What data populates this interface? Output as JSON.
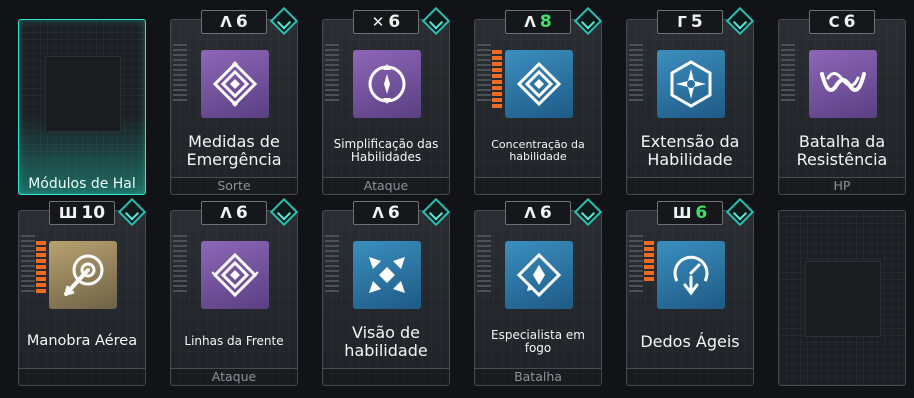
{
  "selected_slot": {
    "label": "Módulos de Hal"
  },
  "modules": [
    {
      "id": "m1",
      "level_glyph": "Λ",
      "level": "6",
      "level_color": "#f2f2f2",
      "name": "Medidas de Emergência",
      "tag": "Sorte",
      "icon": "diamond-lattice-icon",
      "tone": "purple",
      "bars": 0
    },
    {
      "id": "m2",
      "level_glyph": "✕",
      "level": "6",
      "level_color": "#f2f2f2",
      "name": "Simplificação das Habilidades",
      "tag": "Ataque",
      "icon": "circle-arrows-icon",
      "tone": "purple",
      "bars": 0
    },
    {
      "id": "m3",
      "level_glyph": "Λ",
      "level": "8",
      "level_color": "#3ee06a",
      "name": "Concentração da habilidade",
      "tag": "",
      "icon": "diamond-lattice-icon",
      "tone": "blue",
      "bars": 10
    },
    {
      "id": "m4",
      "level_glyph": "Г",
      "level": "5",
      "level_color": "#f2f2f2",
      "name": "Extensão da Habilidade",
      "tag": "",
      "icon": "hex-star-icon",
      "tone": "blue",
      "bars": 0
    },
    {
      "id": "m5",
      "level_glyph": "C",
      "level": "6",
      "level_color": "#f2f2f2",
      "name": "Batalha da Resistência",
      "tag": "HP",
      "icon": "interlinked-w-icon",
      "tone": "purple",
      "bars": 0
    },
    {
      "id": "m6",
      "level_glyph": "Ш",
      "level": "10",
      "level_color": "#f2f2f2",
      "name": "Manobra Aérea",
      "tag": "",
      "icon": "grapple-hook-icon",
      "tone": "gold",
      "bars": 9
    },
    {
      "id": "m7",
      "level_glyph": "Λ",
      "level": "6",
      "level_color": "#f2f2f2",
      "name": "Linhas da Frente",
      "tag": "Ataque",
      "icon": "diamond-lattice-icon",
      "tone": "purple",
      "bars": 0
    },
    {
      "id": "m8",
      "level_glyph": "Λ",
      "level": "6",
      "level_color": "#f2f2f2",
      "name": "Visão de habilidade",
      "tag": "",
      "icon": "x-diamonds-icon",
      "tone": "blue",
      "bars": 0
    },
    {
      "id": "m9",
      "level_glyph": "Λ",
      "level": "6",
      "level_color": "#f2f2f2",
      "name": "Especialista em fogo",
      "tag": "Batalha",
      "icon": "diamond-arrow-icon",
      "tone": "blue",
      "bars": 0
    },
    {
      "id": "m10",
      "level_glyph": "Ш",
      "level": "6",
      "level_color": "#3ee06a",
      "name": "Dedos Ágeis",
      "tag": "",
      "icon": "clock-arrow-icon",
      "tone": "blue",
      "bars": 7
    }
  ],
  "colors": {
    "accent_teal": "#2ee6d0",
    "bar_orange": "#f06a1f",
    "level_green": "#3ee06a"
  }
}
